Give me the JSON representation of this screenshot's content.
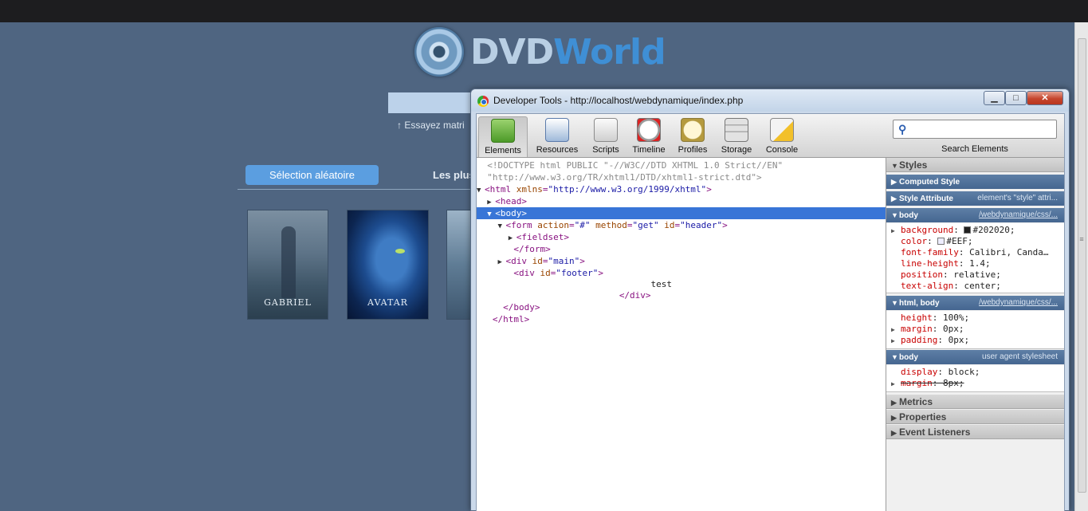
{
  "site": {
    "logo_dvd": "DVD",
    "logo_world": "World",
    "hint": "↑ Essayez matri",
    "tab_active": "Sélection aléatoire",
    "tab_other": "Les plus",
    "posters": [
      {
        "title": "GABRIEL"
      },
      {
        "title": "AVATAR"
      },
      {
        "title": ""
      }
    ]
  },
  "devtools": {
    "title": "Developer Tools - http://localhost/webdynamique/index.php",
    "window_buttons": {
      "minimize": "▁",
      "maximize": "□",
      "close": "✕"
    },
    "toolbar": [
      {
        "label": "Elements",
        "icon": "elements-icon",
        "active": true
      },
      {
        "label": "Resources",
        "icon": "resources-icon"
      },
      {
        "label": "Scripts",
        "icon": "scripts-icon"
      },
      {
        "label": "Timeline",
        "icon": "timeline-icon"
      },
      {
        "label": "Profiles",
        "icon": "profiles-icon"
      },
      {
        "label": "Storage",
        "icon": "storage-icon"
      },
      {
        "label": "Console",
        "icon": "console-icon"
      }
    ],
    "search": {
      "placeholder": "",
      "label": "Search Elements"
    },
    "dom": {
      "doctype1": "<!DOCTYPE html PUBLIC \"-//W3C//DTD XHTML 1.0 Strict//EN\"",
      "doctype2": "\"http://www.w3.org/TR/xhtml1/DTD/xhtml1-strict.dtd\">",
      "html_open_tag": "<html ",
      "html_attr": "xmlns",
      "html_val": "\"http://www.w3.org/1999/xhtml\"",
      "head": "<head>",
      "body": "<body>",
      "form_tag": "<form ",
      "form_action": "action",
      "form_action_val": "\"#\"",
      "form_method": "method",
      "form_method_val": "\"get\"",
      "form_id": "id",
      "form_id_val": "\"header\"",
      "fieldset": "<fieldset>",
      "form_close": "</form>",
      "div_main_tag": "<div ",
      "div_id": "id",
      "div_main_val": "\"main\"",
      "div_footer_val": "\"footer\"",
      "footer_text": "test",
      "div_close": "</div>",
      "body_close": "</body>",
      "html_close": "</html>"
    },
    "styles": {
      "header": "Styles",
      "computed": "Computed Style",
      "style_attr": "Style Attribute",
      "style_attr_note": "element's \"style\" attri...",
      "rule1": {
        "selector": "body",
        "source": "/webdynamique/css/...",
        "props": [
          {
            "name": "background",
            "value": "#202020;",
            "swatch": "#202020",
            "expandable": true
          },
          {
            "name": "color",
            "value": "#EEF;",
            "swatch": "#EEEEFF"
          },
          {
            "name": "font-family",
            "value": "Calibri, Canda…"
          },
          {
            "name": "line-height",
            "value": "1.4;"
          },
          {
            "name": "position",
            "value": "relative;"
          },
          {
            "name": "text-align",
            "value": "center;"
          }
        ]
      },
      "rule2": {
        "selector": "html, body",
        "source": "/webdynamique/css/...",
        "props": [
          {
            "name": "height",
            "value": "100%;"
          },
          {
            "name": "margin",
            "value": "0px;",
            "expandable": true
          },
          {
            "name": "padding",
            "value": "0px;",
            "expandable": true
          }
        ]
      },
      "rule3": {
        "selector": "body",
        "source": "user agent stylesheet",
        "props": [
          {
            "name": "display",
            "value": "block;"
          },
          {
            "name": "margin",
            "value": "8px;",
            "expandable": true,
            "overridden": true
          }
        ]
      },
      "metrics": "Metrics",
      "properties": "Properties",
      "event_listeners": "Event Listeners"
    }
  }
}
